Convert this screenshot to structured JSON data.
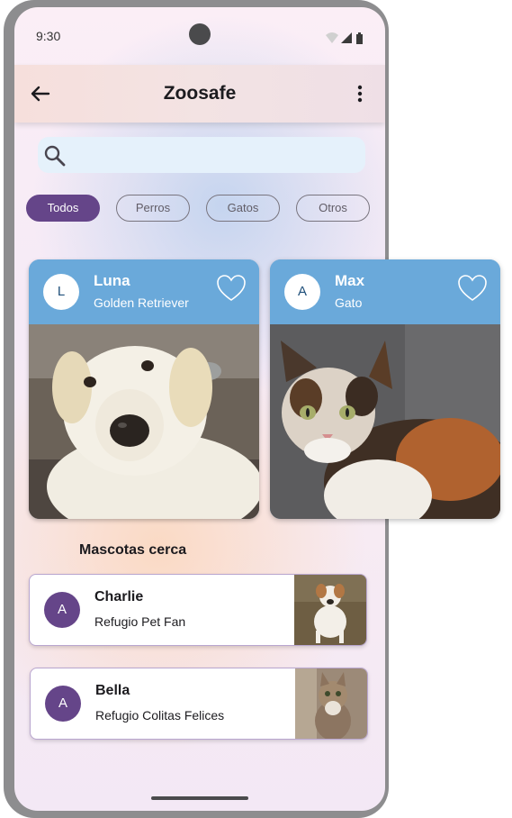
{
  "status_bar": {
    "time": "9:30"
  },
  "app_bar": {
    "title": "Zoosafe",
    "back_icon": "arrow-back-icon",
    "menu_icon": "more-vert-icon"
  },
  "search": {
    "placeholder": "",
    "icon": "search-icon"
  },
  "filters": [
    {
      "label": "Todos",
      "selected": true
    },
    {
      "label": "Perros",
      "selected": false
    },
    {
      "label": "Gatos",
      "selected": false
    },
    {
      "label": "Otros",
      "selected": false
    }
  ],
  "featured_pets": [
    {
      "initial": "L",
      "name": "Luna",
      "breed": "Golden Retriever",
      "photo": "dog-photo"
    },
    {
      "initial": "A",
      "name": "Max",
      "breed": "Gato",
      "photo": "cat-photo"
    }
  ],
  "nearby": {
    "title": "Mascotas cerca",
    "items": [
      {
        "initial": "A",
        "name": "Charlie",
        "shelter": "Refugio Pet Fan",
        "photo": "dog-thumbnail"
      },
      {
        "initial": "A",
        "name": "Bella",
        "shelter": "Refugio Colitas Felices",
        "photo": "cat-thumbnail"
      }
    ]
  },
  "colors": {
    "primary": "#654589",
    "card_header": "#6aa9da",
    "search_bg": "#e5f1fb",
    "app_bar": "#f3e3e3"
  }
}
